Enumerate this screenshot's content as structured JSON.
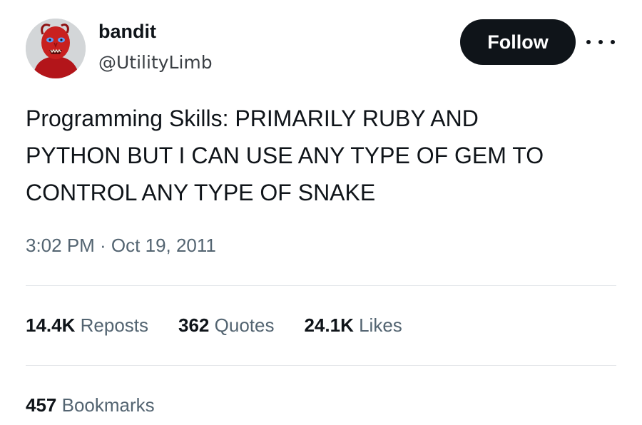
{
  "author": {
    "display_name": "bandit",
    "handle": "@UtilityLimb",
    "avatar_icon": "red-creature-avatar-icon"
  },
  "actions": {
    "follow_label": "Follow",
    "more_icon": "more-options-icon"
  },
  "tweet": {
    "text": "Programming Skills: PRIMARILY RUBY AND\nPYTHON BUT I CAN USE ANY TYPE OF GEM TO\nCONTROL ANY TYPE OF SNAKE",
    "timestamp": "3:02 PM · Oct 19, 2011"
  },
  "stats": {
    "reposts": {
      "count": "14.4K",
      "label": "Reposts"
    },
    "quotes": {
      "count": "362",
      "label": "Quotes"
    },
    "likes": {
      "count": "24.1K",
      "label": "Likes"
    },
    "bookmarks": {
      "count": "457",
      "label": "Bookmarks"
    }
  },
  "colors": {
    "text_primary": "#0f1419",
    "text_secondary": "#536471",
    "button_bg": "#0f1419",
    "divider": "#e4e7ea",
    "avatar_red": "#c21a1a"
  }
}
